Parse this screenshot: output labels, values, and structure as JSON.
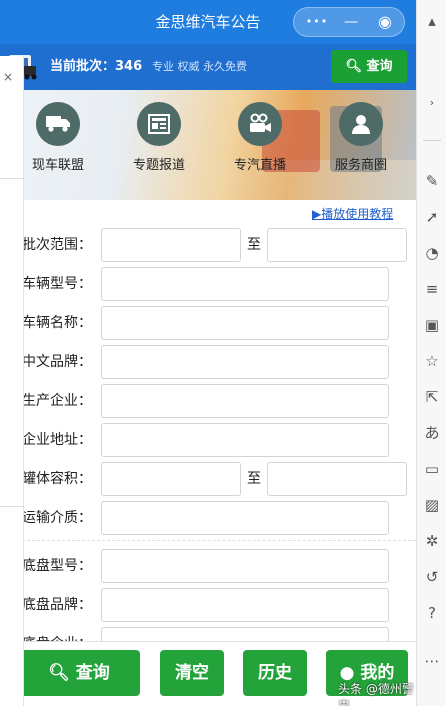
{
  "window": {
    "title": "金思维汽车公告",
    "capsule": {
      "more": "•••",
      "minimize": "—",
      "close": "◉"
    }
  },
  "batchbar": {
    "batch_label": "当前批次：346",
    "slogan": "专业 权威 永久免费",
    "query_button": "查询"
  },
  "categories": [
    {
      "label": "现车联盟",
      "icon": "truck-icon"
    },
    {
      "label": "专题报道",
      "icon": "newspaper-icon"
    },
    {
      "label": "专汽直播",
      "icon": "video-camera-icon"
    },
    {
      "label": "服务商圈",
      "icon": "user-icon"
    }
  ],
  "tutorial_link": "▶播放使用教程",
  "form": {
    "batch_range": "批次范围：",
    "to": "至",
    "vehicle_model": "车辆型号：",
    "vehicle_name": "车辆名称：",
    "cn_brand": "中文品牌：",
    "manufacturer": "生产企业：",
    "company_address": "企业地址：",
    "tank_volume": "罐体容积：",
    "transport_medium": "运输介质：",
    "chassis_model": "底盘型号：",
    "chassis_brand": "底盘品牌：",
    "chassis_company": "底盘企业："
  },
  "bottom": {
    "query": "查询",
    "clear": "清空",
    "history": "历史",
    "mine": "我的"
  },
  "watermark": "头条 @德州警事",
  "colors": {
    "titlebar": "#1f7de0",
    "batchbar": "#1e6fd0",
    "green": "#24a33b",
    "link": "#1f5fcf"
  }
}
